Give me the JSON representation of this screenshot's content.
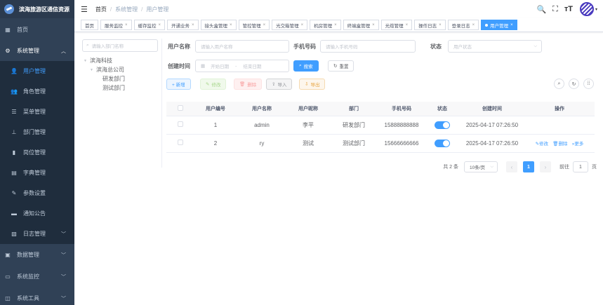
{
  "sidebar": {
    "logo_text": "滨海旅游区通信资源",
    "items": [
      {
        "label": "首页",
        "icon": "dashboard-icon"
      },
      {
        "label": "系统管理",
        "icon": "gear-icon"
      },
      {
        "label": "用户管理",
        "icon": "user-icon"
      },
      {
        "label": "角色管理",
        "icon": "peoples-icon"
      },
      {
        "label": "菜单管理",
        "icon": "tree-table-icon"
      },
      {
        "label": "部门管理",
        "icon": "tree-icon"
      },
      {
        "label": "岗位管理",
        "icon": "post-icon"
      },
      {
        "label": "字典管理",
        "icon": "dict-icon"
      },
      {
        "label": "参数设置",
        "icon": "edit-icon"
      },
      {
        "label": "通知公告",
        "icon": "message-icon"
      },
      {
        "label": "日志管理",
        "icon": "log-icon"
      },
      {
        "label": "数据管理",
        "icon": "data-icon"
      },
      {
        "label": "系统监控",
        "icon": "monitor-icon"
      },
      {
        "label": "系统工具",
        "icon": "tool-icon"
      }
    ]
  },
  "header": {
    "breadcrumb": [
      "首页",
      "系统管理",
      "用户管理"
    ]
  },
  "tags": [
    "首页",
    "服务监控",
    "缓存监控",
    "开通业务",
    "接头盒管理",
    "管控管理",
    "光交箱管理",
    "机房管理",
    "终端盒管理",
    "光缆管理",
    "操作日志",
    "登录日志",
    "用户管理"
  ],
  "tree": {
    "search_placeholder": "请输入部门名称",
    "nodes": [
      "滨海科技",
      "滨海总公司",
      "研发部门",
      "测试部门"
    ]
  },
  "form": {
    "username_label": "用户名称",
    "username_placeholder": "请输入用户名称",
    "phone_label": "手机号码",
    "phone_placeholder": "请输入手机号码",
    "status_label": "状态",
    "status_placeholder": "用户状态",
    "created_label": "创建时间",
    "start_placeholder": "开始日期",
    "range_sep": "-",
    "end_placeholder": "结束日期",
    "search_btn": "搜索",
    "reset_btn": "重置"
  },
  "toolbar": {
    "add": "+ 新增",
    "edit": "修改",
    "delete": "删除",
    "import": "导入",
    "export": "导出"
  },
  "table": {
    "columns": [
      "用户编号",
      "用户名称",
      "用户昵称",
      "部门",
      "手机号码",
      "状态",
      "创建时间",
      "操作"
    ],
    "rows": [
      {
        "id": "1",
        "username": "admin",
        "nickname": "李平",
        "dept": "研发部门",
        "phone": "15888888888",
        "status_on": true,
        "created": "2025-04-17 07:26:50",
        "ops": []
      },
      {
        "id": "2",
        "username": "ry",
        "nickname": "测试",
        "dept": "测试部门",
        "phone": "15666666666",
        "status_on": true,
        "created": "2025-04-17 07:26:50",
        "ops": [
          "修改",
          "删除",
          "更多"
        ]
      }
    ]
  },
  "pager": {
    "total": "共 2 条",
    "size": "10条/页",
    "current": "1",
    "goto_label": "前往",
    "goto_value": "1",
    "page_suffix": "页"
  },
  "colors": {
    "sidebar_bg": "#304156",
    "accent": "#409eff"
  }
}
